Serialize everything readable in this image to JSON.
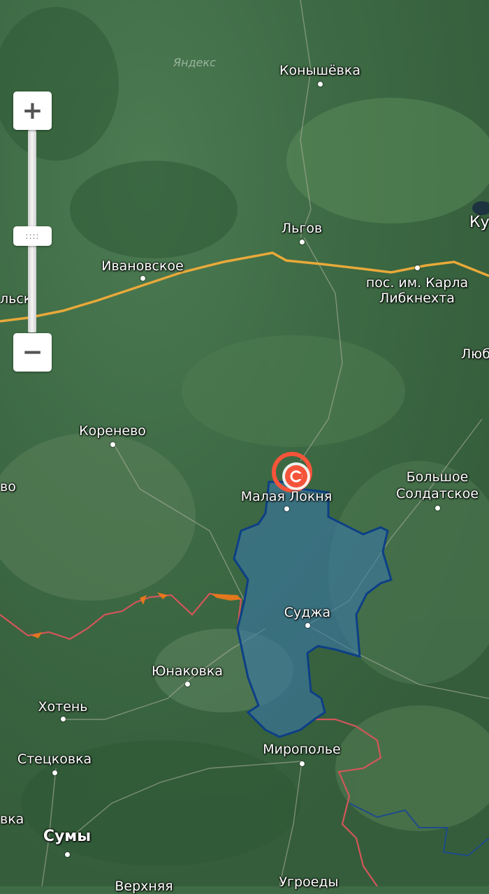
{
  "watermark": "Яндекс",
  "zoom": {
    "in_label": "+",
    "out_label": "−",
    "handle_label": "::::"
  },
  "places": [
    {
      "id": "konyshevka",
      "name": "Конышёвка"
    },
    {
      "id": "lgov",
      "name": "Льгов"
    },
    {
      "id": "ku",
      "name": "Ку"
    },
    {
      "id": "ivanovskoe",
      "name": "Ивановское"
    },
    {
      "id": "lsk",
      "name": "льск"
    },
    {
      "id": "karla-1",
      "name": "пос. им. Карла"
    },
    {
      "id": "karla-2",
      "name": "Либкнехта"
    },
    {
      "id": "lyub",
      "name": "Люб"
    },
    {
      "id": "korenevo",
      "name": "Коренево"
    },
    {
      "id": "bolshoe-1",
      "name": "Большое"
    },
    {
      "id": "bolshoe-2",
      "name": "Солдатское"
    },
    {
      "id": "vo",
      "name": "во"
    },
    {
      "id": "malaya-loknya",
      "name": "Малая Локня"
    },
    {
      "id": "sudzha",
      "name": "Суджа"
    },
    {
      "id": "yunakovka",
      "name": "Юнаковка"
    },
    {
      "id": "khoten",
      "name": "Хотень"
    },
    {
      "id": "stetskovka",
      "name": "Стецковка"
    },
    {
      "id": "miropole",
      "name": "Миропольe"
    },
    {
      "id": "vka",
      "name": "вка"
    },
    {
      "id": "sumy",
      "name": "Сумы"
    },
    {
      "id": "verkhnyaya",
      "name": "Верхняя"
    },
    {
      "id": "ugroedy",
      "name": "Угроеды"
    }
  ],
  "colors": {
    "highway": "#e8a93a",
    "border": "#d2565a",
    "occupied_fill": "#3a78a8",
    "occupied_stroke": "#0d3f86",
    "disputed": "#f07a1a",
    "marker": "#f5543a"
  },
  "icons": {
    "zoom_in": "plus-icon",
    "zoom_out": "minus-icon",
    "marker": "location-marker-icon"
  }
}
